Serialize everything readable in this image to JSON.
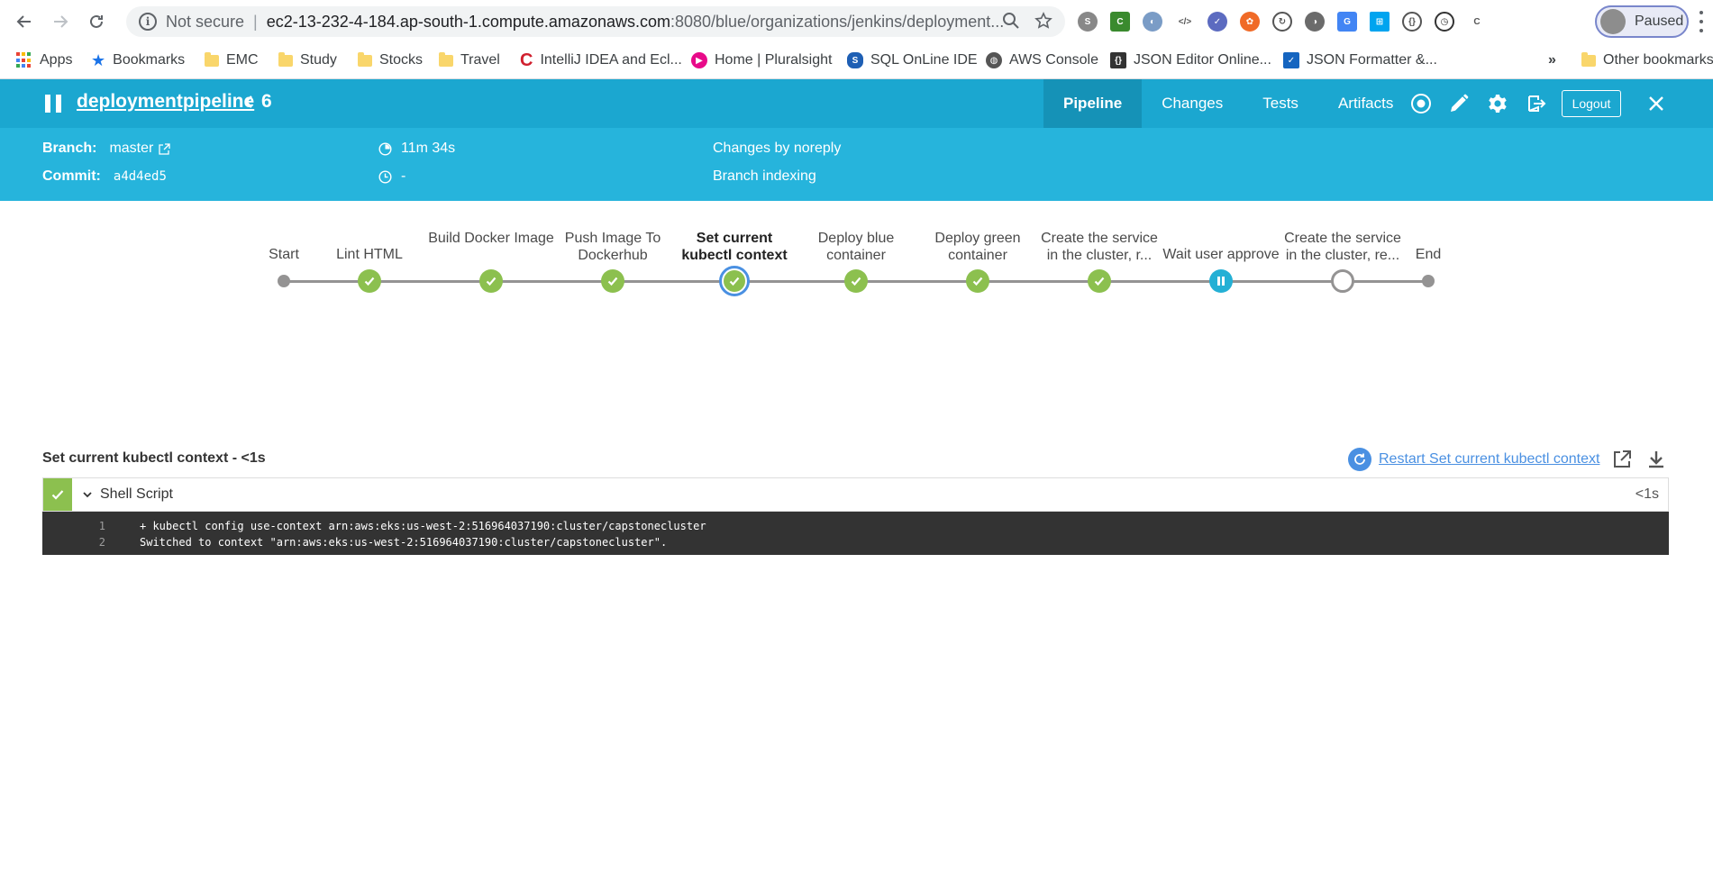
{
  "browser": {
    "not_secure": "Not secure",
    "url_host": "ec2-13-232-4-184.ap-south-1.compute.amazonaws.com",
    "url_path": ":8080/blue/organizations/jenkins/deployment...",
    "profile_label": "Paused",
    "bookmarks": [
      {
        "label": "Apps"
      },
      {
        "label": "Bookmarks"
      },
      {
        "label": "EMC"
      },
      {
        "label": "Study"
      },
      {
        "label": "Stocks"
      },
      {
        "label": "Travel"
      },
      {
        "label": "IntelliJ IDEA and Ecl..."
      },
      {
        "label": "Home | Pluralsight"
      },
      {
        "label": "SQL OnLine IDE"
      },
      {
        "label": "AWS Console"
      },
      {
        "label": "JSON Editor Online..."
      },
      {
        "label": "JSON Formatter &..."
      },
      {
        "label": "»"
      },
      {
        "label": "Other bookmarks"
      }
    ]
  },
  "header": {
    "pipeline_name": "deploymentpipeline",
    "run_number": "6",
    "tabs": [
      {
        "label": "Pipeline"
      },
      {
        "label": "Changes"
      },
      {
        "label": "Tests"
      },
      {
        "label": "Artifacts"
      }
    ],
    "logout_label": "Logout"
  },
  "run_info": {
    "branch_label": "Branch:",
    "branch_value": "master",
    "commit_label": "Commit:",
    "commit_value": "a4d4ed5",
    "duration": "11m 34s",
    "finished": "-",
    "changes": "Changes by noreply",
    "cause": "Branch indexing"
  },
  "stages": [
    {
      "label": "Start",
      "status": "start"
    },
    {
      "label": "Lint HTML",
      "status": "success"
    },
    {
      "label": "Build Docker Image",
      "status": "success"
    },
    {
      "label": "Push Image To Dockerhub",
      "status": "success"
    },
    {
      "label": "Set current kubectl context",
      "status": "selected"
    },
    {
      "label": "Deploy blue container",
      "status": "success"
    },
    {
      "label": "Deploy green container",
      "status": "success"
    },
    {
      "label": "Create the service in the cluster, r...",
      "status": "success"
    },
    {
      "label": "Wait user approve",
      "status": "paused"
    },
    {
      "label": "Create the service in the cluster, re...",
      "status": "not_built"
    },
    {
      "label": "End",
      "status": "end"
    }
  ],
  "log": {
    "title": "Set current kubectl context - <1s",
    "restart_label": "Restart Set current kubectl context",
    "step_name": "Shell Script",
    "step_duration": "<1s",
    "lines": [
      {
        "num": "1",
        "text": "+ kubectl config use-context arn:aws:eks:us-west-2:516964037190:cluster/capstonecluster"
      },
      {
        "num": "2",
        "text": "Switched to context \"arn:aws:eks:us-west-2:516964037190:cluster/capstonecluster\"."
      }
    ]
  },
  "colors": {
    "header_bg": "#1ba7d0",
    "subheader_bg": "#26b4dc",
    "success": "#8cc04f",
    "paused": "#24b0d5",
    "selected_ring": "#4a90e2",
    "console_bg": "#333333"
  }
}
